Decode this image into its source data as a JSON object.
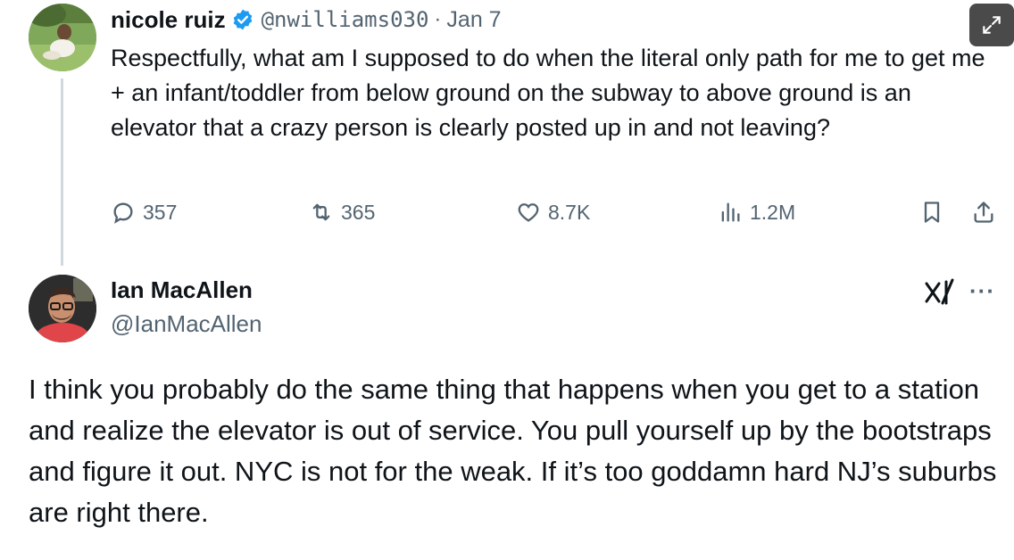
{
  "tweet1": {
    "author_name": "nicole ruiz",
    "handle": "@nwilliams030",
    "separator": "·",
    "date": "Jan 7",
    "text": "Respectfully, what am I supposed to do when the literal only path for me to get me + an infant/toddler from below ground on the subway to above ground is an elevator that a crazy person is clearly posted up in and not leaving?",
    "replies": "357",
    "reposts": "365",
    "likes": "8.7K",
    "views": "1.2M"
  },
  "tweet2": {
    "author_name": "Ian MacAllen",
    "handle": "@IanMacAllen",
    "text": "I think you probably do the same thing that happens when you get to a station and realize the elevator is out of service. You pull yourself up by the bootstraps and figure it out. NYC is not for the weak. If it’s too goddamn hard NJ’s suburbs are right there.",
    "more_label": "···"
  },
  "icons": {
    "verified": "verified-badge-icon",
    "reply": "reply-icon",
    "repost": "repost-icon",
    "like": "heart-icon",
    "views": "views-icon",
    "bookmark": "bookmark-icon",
    "share": "share-icon",
    "grok": "grok-icon",
    "expand": "expand-icon"
  },
  "colors": {
    "text_primary": "#0f1419",
    "text_secondary": "#536471",
    "verified_blue": "#1d9bf0",
    "thread_line": "#cfd9de"
  }
}
